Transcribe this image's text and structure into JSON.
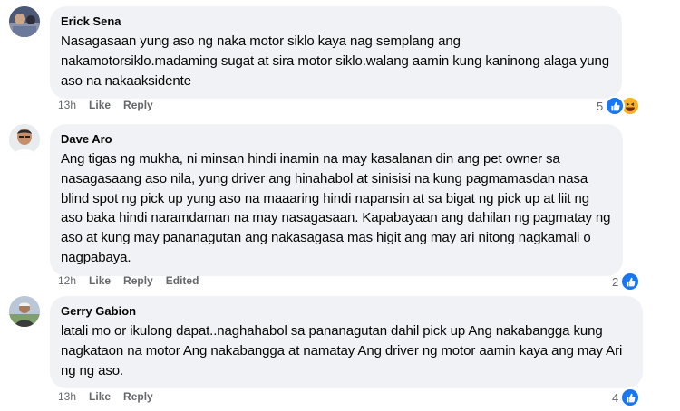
{
  "comments": [
    {
      "author": "Erick Sena",
      "text": "Nasagasaan yung aso ng naka motor siklo kaya nag semplang ang nakamotorsiklo.madaming sugat at sira motor siklo.walang aamin kung kaninong alaga yung aso na nakaaksidente",
      "time": "13h",
      "like_label": "Like",
      "reply_label": "Reply",
      "edited_label": "",
      "reaction_count": "5",
      "reaction_icons": [
        "like-icon",
        "haha-icon"
      ]
    },
    {
      "author": "Dave Aro",
      "text": "Ang tigas ng mukha, ni minsan hindi inamin na may kasalanan din ang pet owner sa nasagasaang aso nila, yung driver ang hinahabol at sinisisi na kung pagmamasdan nasa blind spot ng pick up yung aso na maaaring hindi napansin at sa bigat ng pick up at liit ng aso baka hindi naramdaman na may nasagasaan. Kapabayaan ang dahilan ng pagmatay ng aso at kung may pananagutan ang nakasagasa mas higit ang may ari nitong nagkamali o nagpabaya.",
      "time": "12h",
      "like_label": "Like",
      "reply_label": "Reply",
      "edited_label": "Edited",
      "reaction_count": "2",
      "reaction_icons": [
        "like-icon"
      ]
    },
    {
      "author": "Gerry Gabion",
      "text": "latali mo or ikulong dapat..naghahabol sa pananagutan dahil pick up Ang nakabangga kung nagkataon na motor Ang nakabangga at namatay Ang driver ng motor aamin kaya ang may Ari ng ng aso.",
      "time": "13h",
      "like_label": "Like",
      "reply_label": "Reply",
      "edited_label": "",
      "reaction_count": "4",
      "reaction_icons": [
        "like-icon"
      ]
    }
  ],
  "colors": {
    "bubble": "#f0f2f5",
    "meta_text": "#65676b",
    "like_blue": "#1877f2",
    "haha_yellow": "#f7b125"
  }
}
